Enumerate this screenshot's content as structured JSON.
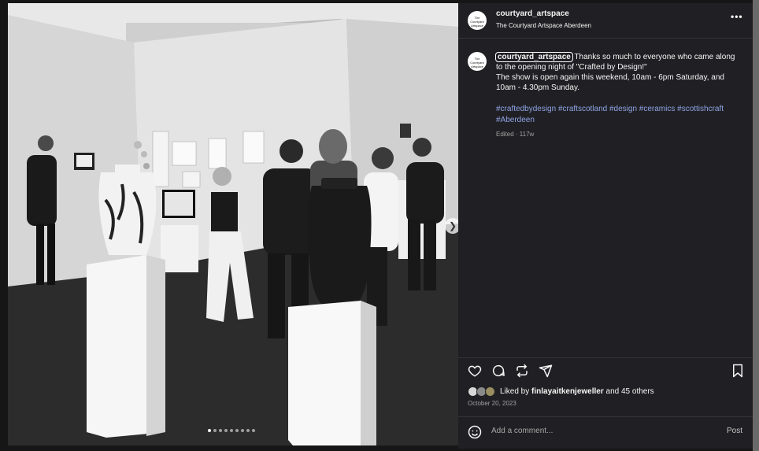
{
  "post": {
    "username": "courtyard_artspace",
    "location": "The Courtyard Artspace Aberdeen",
    "avatar_text": "The Courtyard Artspace",
    "more_icon": "more-horizontal-icon",
    "caption_username": "courtyard_artspace",
    "caption_line1": "Thanks so much to everyone who came along to the opening night of \"Crafted by Design!\"",
    "caption_line2": "The show is open again this weekend, 10am - 6pm Saturday, and 10am - 4.30pm Sunday.",
    "hashtags": "#craftedbydesign #craftscotland #design #ceramics #scottishcraft #Aberdeen",
    "edited": "Edited · 117w"
  },
  "carousel": {
    "slide_count": 9,
    "active_index": 0,
    "next_icon": "chevron-right-icon"
  },
  "actions": {
    "like_icon": "heart-icon",
    "comment_icon": "comment-bubble-icon",
    "share_icon": "repost-icon",
    "send_icon": "send-icon",
    "save_icon": "bookmark-icon"
  },
  "likes": {
    "prefix": "Liked by ",
    "user": "finlayaitkenjeweller",
    "suffix": " and 45 others"
  },
  "date": "October 20, 2023",
  "comment": {
    "placeholder": "Add a comment...",
    "post_label": "Post",
    "emoji_icon": "emoji-icon"
  },
  "colors": {
    "panel_bg": "#202024",
    "hashtag": "#8fa4e6",
    "muted": "#a0a0a0"
  }
}
